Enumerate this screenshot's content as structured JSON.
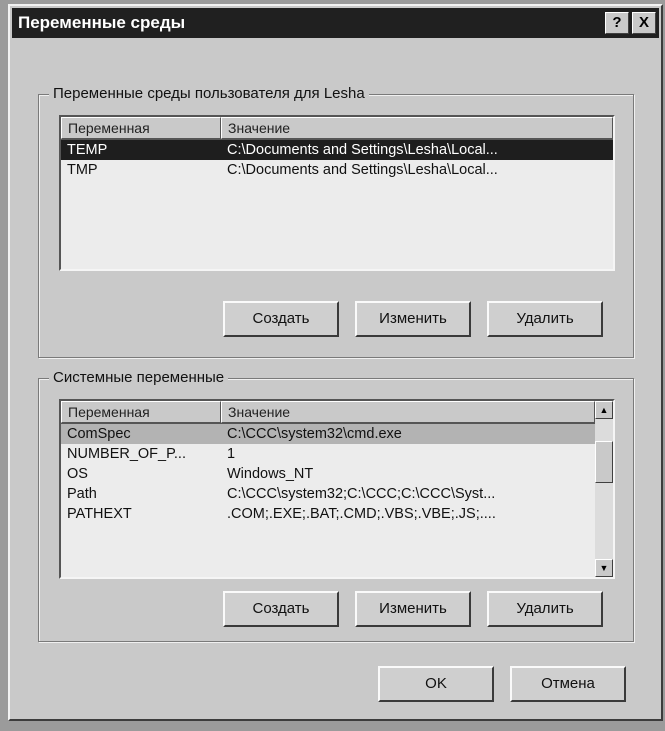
{
  "window": {
    "title": "Переменные среды",
    "help_label": "?",
    "close_label": "X"
  },
  "user_vars": {
    "legend": "Переменные среды пользователя для Lesha",
    "columns": [
      "Переменная",
      "Значение"
    ],
    "rows": [
      {
        "name": "TEMP",
        "value": "C:\\Documents and Settings\\Lesha\\Local..."
      },
      {
        "name": "TMP",
        "value": "C:\\Documents and Settings\\Lesha\\Local..."
      }
    ],
    "buttons": {
      "create": "Создать",
      "edit": "Изменить",
      "delete": "Удалить"
    }
  },
  "system_vars": {
    "legend": "Системные переменные",
    "columns": [
      "Переменная",
      "Значение"
    ],
    "rows": [
      {
        "name": "ComSpec",
        "value": "C:\\CCC\\system32\\cmd.exe"
      },
      {
        "name": "NUMBER_OF_P...",
        "value": "1"
      },
      {
        "name": "OS",
        "value": "Windows_NT"
      },
      {
        "name": "Path",
        "value": "C:\\CCC\\system32;C:\\CCC;C:\\CCC\\Syst..."
      },
      {
        "name": "PATHEXT",
        "value": ".COM;.EXE;.BAT;.CMD;.VBS;.VBE;.JS;...."
      }
    ],
    "buttons": {
      "create": "Создать",
      "edit": "Изменить",
      "delete": "Удалить"
    }
  },
  "footer": {
    "ok": "OK",
    "cancel": "Отмена"
  },
  "icons": {
    "scroll_up": "scroll-up-arrow-icon",
    "scroll_down": "scroll-down-arrow-icon"
  }
}
